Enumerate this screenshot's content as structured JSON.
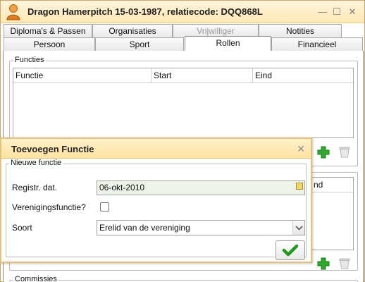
{
  "window": {
    "title": "Dragon Hamerpitch  15-03-1987, relatiecode: DQQ868L",
    "controls": {
      "minimize": "—",
      "maximize": "☐",
      "close": "✕"
    }
  },
  "tabs_row1": [
    {
      "label": "Diploma's & Passen"
    },
    {
      "label": "Organisaties"
    },
    {
      "label": "Vrijwilliger"
    },
    {
      "label": "Notities"
    }
  ],
  "tabs_row2": [
    {
      "label": "Persoon"
    },
    {
      "label": "Sport"
    },
    {
      "label": "Rollen"
    },
    {
      "label": "Financieel"
    }
  ],
  "functies": {
    "legend": "Functies",
    "columns": [
      "Functie",
      "Start",
      "Eind"
    ]
  },
  "second_grid": {
    "visible_column": "nd"
  },
  "commissies": {
    "legend": "Commissies"
  },
  "dialog": {
    "title": "Toevoegen Functie",
    "close": "✕",
    "fieldset_legend": "Nieuwe functie",
    "registr_label": "Registr. dat.",
    "registr_value": "06-okt-2010",
    "verenigingsfunctie_label": "Verenigingsfunctie?",
    "verenigingsfunctie_checked": false,
    "soort_label": "Soort",
    "soort_value": "Erelid van de vereniging"
  },
  "colors": {
    "titlebar": "#ffe8b4",
    "dialog_border": "#e3c27a",
    "add_green": "#2ea82e",
    "ok_green": "#1f9a1f"
  }
}
